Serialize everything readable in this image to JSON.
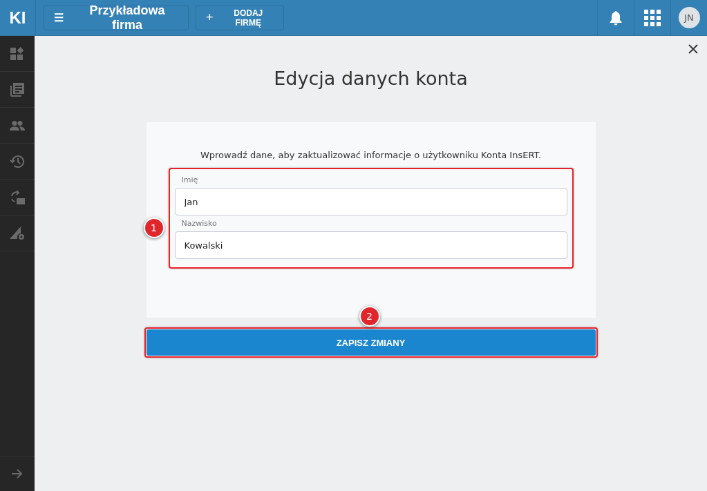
{
  "topbar": {
    "logo": "KI",
    "company": "Przykładowa firma",
    "add_company": "DODAJ FIRMĘ",
    "menu_icon": "☰",
    "add_icon": "+",
    "avatar": "JN"
  },
  "sidebar": {
    "items": [
      {
        "kind": "dashboard"
      },
      {
        "kind": "documents"
      },
      {
        "kind": "people"
      },
      {
        "kind": "history"
      },
      {
        "kind": "sync"
      },
      {
        "kind": "settings"
      }
    ]
  },
  "dialog": {
    "title": "Edycja danych konta",
    "intro": "Wprowadź dane, aby zaktualizować informacje o użytkowniku Konta InsERT.",
    "fields": [
      {
        "label": "Imię",
        "value": "Jan"
      },
      {
        "label": "Nazwisko",
        "value": "Kowalski"
      }
    ],
    "save_button": "ZAPISZ ZMIANY"
  },
  "annotations": [
    {
      "label": "1"
    },
    {
      "label": "2"
    }
  ]
}
